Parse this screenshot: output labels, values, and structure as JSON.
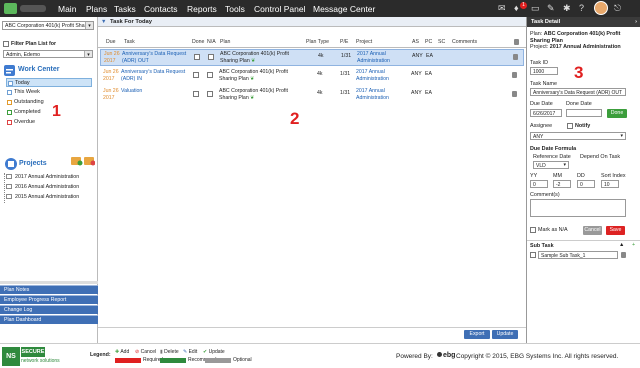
{
  "nav": {
    "items": [
      "Main",
      "Plans",
      "Tasks",
      "Contacts",
      "Reports",
      "Tools",
      "Control Panel",
      "Message Center"
    ],
    "badge": "1"
  },
  "left": {
    "plan_select": "ABC Corporation 401(k) Profit Sha",
    "filter_label": "Filter Plan List for",
    "filter_value": "Admin, Edemo",
    "work_center_title": "Work Center",
    "work_items": [
      "Today",
      "This Week",
      "Outstanding",
      "Completed",
      "Overdue"
    ],
    "projects_title": "Projects",
    "projects": [
      "2017 Annual Administration",
      "2016 Annual Administration",
      "2015 Annual Administration"
    ],
    "links": [
      "Plan Notes",
      "Employee Progress Report",
      "Change Log",
      "Plan Dashboard"
    ],
    "marker": "1"
  },
  "center": {
    "title": "Task For Today",
    "columns": [
      "Due",
      "Task",
      "Done",
      "N/A",
      "Plan",
      "Plan Type",
      "P/E",
      "Project",
      "AS",
      "PC",
      "SC",
      "Comments"
    ],
    "rows": [
      {
        "due1": "Jun 26",
        "due2": "2017",
        "task1": "Anniversary's Data Request",
        "task2": "(ADR) OUT",
        "plan1": "ABC Corporation 401(k) Profit",
        "plan2": "Sharing Plan",
        "type": "4k",
        "pe": "1/31",
        "proj1": "2017 Annual",
        "proj2": "Administration",
        "as": "ANY",
        "pc": "EA"
      },
      {
        "due1": "Jun 26",
        "due2": "2017",
        "task1": "Anniversary's Data Request",
        "task2": "(ADR) IN",
        "plan1": "ABC Corporation 401(k) Profit",
        "plan2": "Sharing Plan",
        "type": "4k",
        "pe": "1/31",
        "proj1": "2017 Annual",
        "proj2": "Administration",
        "as": "ANY",
        "pc": "EA"
      },
      {
        "due1": "Jun 26",
        "due2": "2017",
        "task1": "Valuation",
        "task2": "",
        "plan1": "ABC Corporation 401(k) Profit",
        "plan2": "Sharing Plan",
        "type": "4k",
        "pe": "1/31",
        "proj1": "2017 Annual",
        "proj2": "Administration",
        "as": "ANY",
        "pc": "EA"
      }
    ],
    "export_label": "Export",
    "update_label": "Update",
    "marker": "2"
  },
  "right": {
    "title": "Task Detail",
    "plan_label": "Plan:",
    "plan_value1": "ABC Corporation 401(k) Profit",
    "plan_value2": "Sharing Plan",
    "project_label": "Project:",
    "project_value": "2017 Annual Administration",
    "task_id_label": "Task ID",
    "task_id": "1000",
    "task_name_label": "Task Name",
    "task_name": "Anniversary's Data Request (ADR) OUT",
    "due_date_label": "Due Date",
    "due_date": "6/26/2017",
    "done_date_label": "Done Date",
    "done_btn": "Done",
    "assignee_label": "Assignee",
    "notify_label": "Notify",
    "assignee_value": "ANY",
    "formula_label": "Due Date Formula",
    "ref_date_label": "Reference Date",
    "ref_date_value": "VLD",
    "depend_label": "Depend On Task",
    "yy_label": "YY",
    "mm_label": "MM",
    "dd_label": "DD",
    "sort_label": "Sort Index",
    "yy": "0",
    "mm": "-2",
    "dd": "0",
    "sort": "10",
    "comments_label": "Comment(s)",
    "mark_na_label": "Mark as N/A",
    "cancel_btn": "Cancel",
    "save_btn": "Save",
    "subtask_title": "Sub Task",
    "subtask_value": "Sample Sub Task_1",
    "marker": "3"
  },
  "footer": {
    "ns_badge": "NS",
    "secure": "SECURE",
    "network": "network solutions",
    "legend_label": "Legend:",
    "legend_items": [
      "Add",
      "Cancel",
      "Delete",
      "Edit",
      "Update"
    ],
    "legend_bars": [
      "Required",
      "Recommend",
      "Optional"
    ],
    "powered": "Powered By:",
    "ebg": "ebg",
    "copyright": "Copyright © 2015, EBG Systems Inc. All rights reserved."
  },
  "colors": {
    "nav_bg": "#2b2b2b",
    "accent_blue": "#3f6fb5",
    "required": "#e02020",
    "recommend": "#2f8a3d",
    "optional": "#999999"
  }
}
